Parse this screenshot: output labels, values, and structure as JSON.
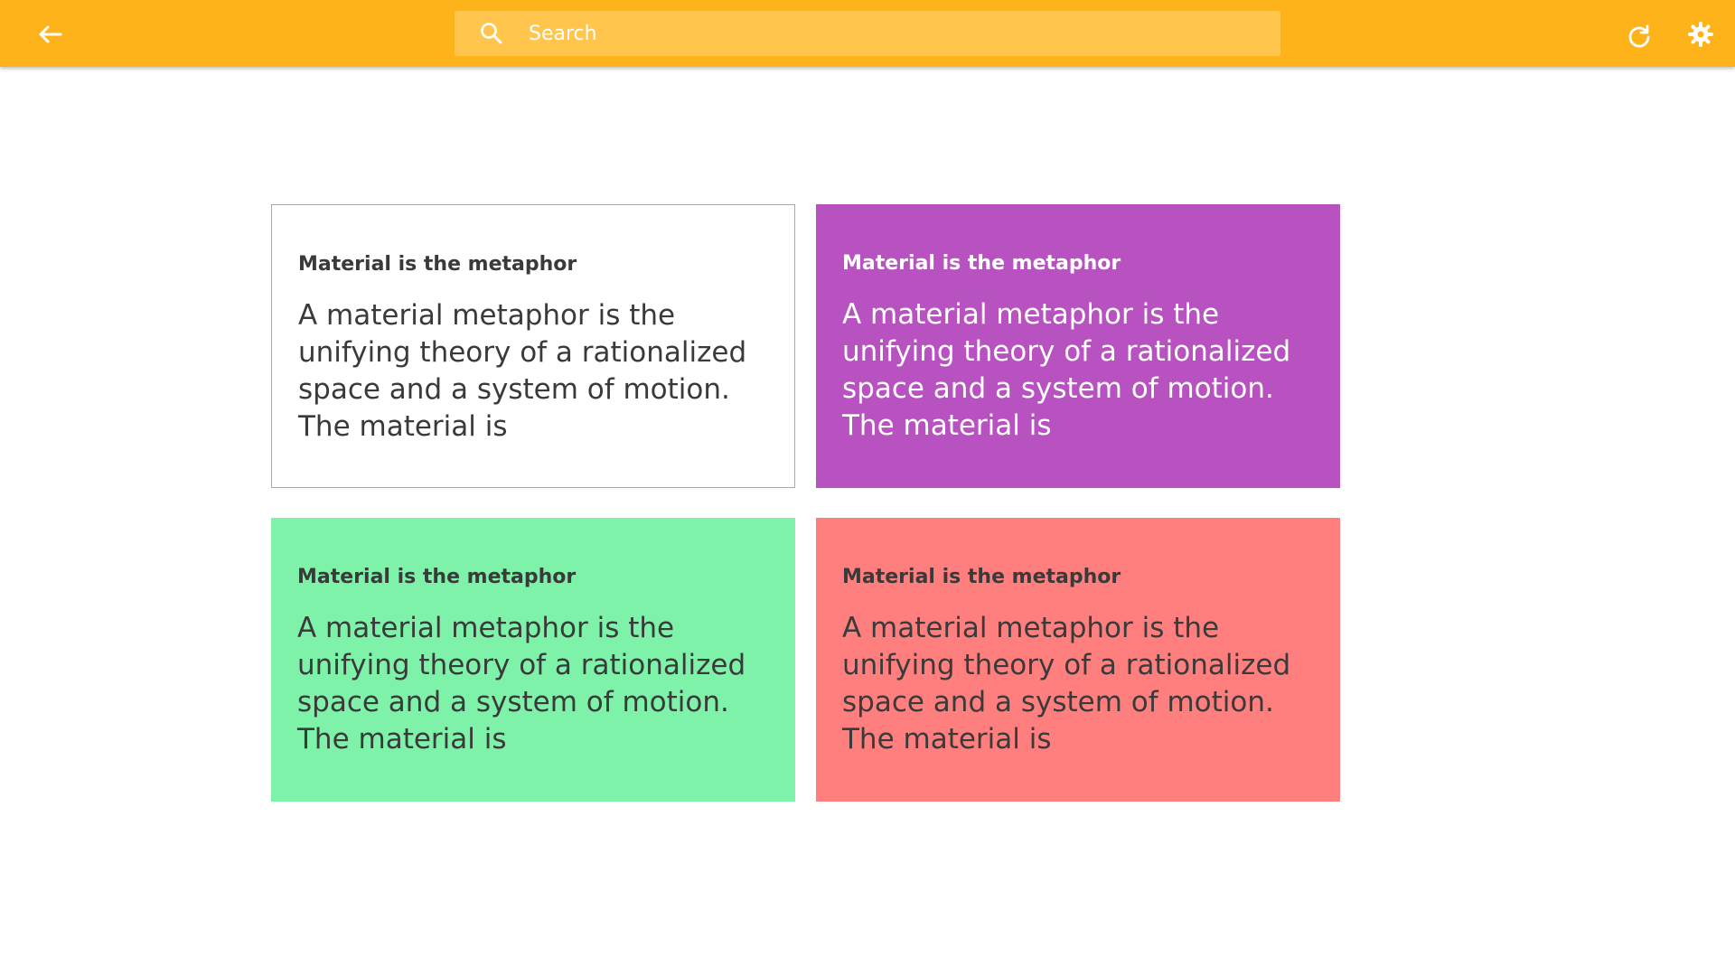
{
  "header": {
    "search_placeholder": "Search",
    "back_icon": "back-arrow-icon",
    "refresh_icon": "refresh-icon",
    "settings_icon": "settings-icon",
    "colors": {
      "bar": "#ffb31a",
      "search_field": "#ffc54d"
    }
  },
  "cards": [
    {
      "title": "Material is the metaphor",
      "text": "A material metaphor is the unifying theory of a rationalized space and a system of motion. The material is",
      "color": "#ffffff"
    },
    {
      "title": "Material is the metaphor",
      "text": "A material metaphor is the unifying theory of a rationalized space and a system of motion. The material is",
      "color": "#b852c0"
    },
    {
      "title": "Material is the metaphor",
      "text": "A material metaphor is the unifying theory of a rationalized space and a system of motion. The material is",
      "color": "#7df2a8"
    },
    {
      "title": "Material is the metaphor",
      "text": "A material metaphor is the unifying theory of a rationalized space and a system of motion. The material is",
      "color": "#ff7f7f"
    }
  ]
}
